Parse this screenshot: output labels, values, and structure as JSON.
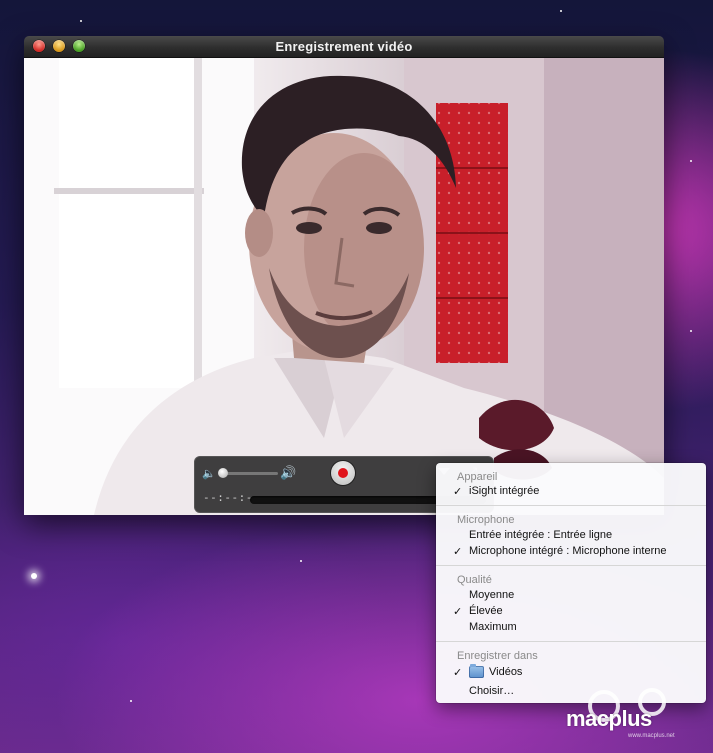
{
  "window": {
    "title": "Enregistrement vidéo"
  },
  "controller": {
    "time": "--:--:--"
  },
  "menu": {
    "sections": [
      {
        "header": "Appareil",
        "items": [
          {
            "label": "iSight intégrée",
            "checked": true
          }
        ]
      },
      {
        "header": "Microphone",
        "items": [
          {
            "label": "Entrée intégrée : Entrée ligne",
            "checked": false
          },
          {
            "label": "Microphone intégré : Microphone interne",
            "checked": true
          }
        ]
      },
      {
        "header": "Qualité",
        "items": [
          {
            "label": "Moyenne",
            "checked": false
          },
          {
            "label": "Élevée",
            "checked": true
          },
          {
            "label": "Maximum",
            "checked": false
          }
        ]
      },
      {
        "header": "Enregistrer dans",
        "items": [
          {
            "label": "Vidéos",
            "checked": true,
            "icon": "folder-icon"
          },
          {
            "label": "Choisir…",
            "checked": false
          }
        ]
      }
    ]
  },
  "watermark": {
    "text": "macplus",
    "sub": "www.macplus.net"
  },
  "colors": {
    "record": "#e0141b",
    "titlebar": "#2e2e2e"
  }
}
